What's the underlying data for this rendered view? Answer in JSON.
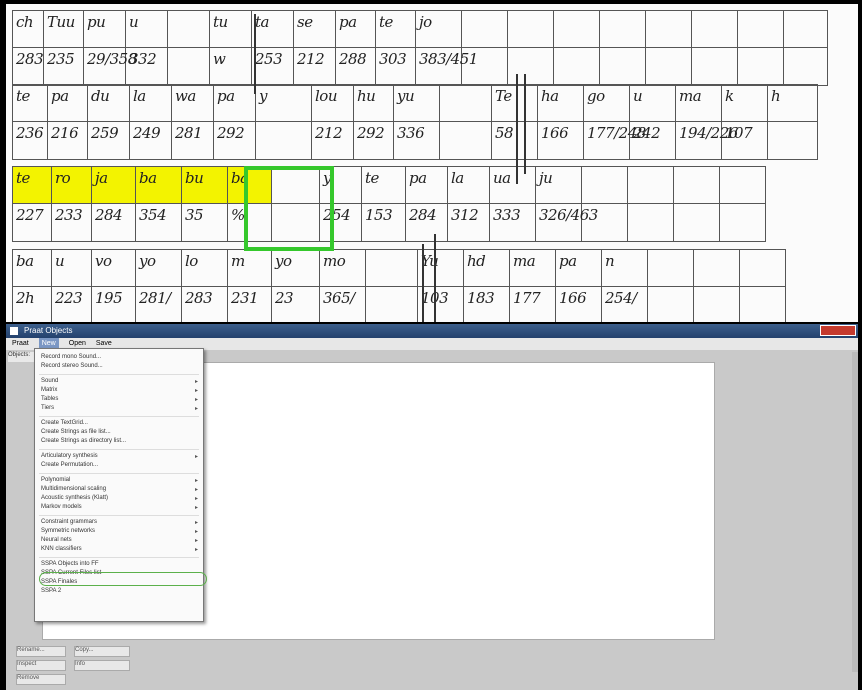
{
  "sheet": {
    "rows": [
      {
        "labels": [
          "ch",
          "Tuu",
          "pu",
          "u",
          "",
          "tu",
          "ta",
          "se",
          "pa",
          "te",
          "jo",
          "",
          "",
          "",
          "",
          "",
          "",
          "",
          ""
        ],
        "values": [
          "283",
          "235",
          "29/358",
          "332",
          "",
          "w",
          "253",
          "212",
          "288",
          "303",
          "383/451",
          "",
          "",
          "",
          "",
          "",
          "",
          "",
          ""
        ]
      },
      {
        "labels": [
          "te",
          "pa",
          "du",
          "la",
          "wa",
          "pa",
          "y",
          "lou",
          "hu",
          "yu",
          "",
          "Te",
          "ha",
          "go",
          "u",
          "ma",
          "k",
          "h"
        ],
        "values": [
          "236",
          "216",
          "259",
          "249",
          "281",
          "292",
          "",
          "212",
          "292",
          "336",
          "",
          "58",
          "166",
          "177/248",
          "242",
          "194/226",
          "107",
          ""
        ]
      },
      {
        "labels": [
          "te",
          "ro",
          "ja",
          "ba",
          "bu",
          "ba",
          "",
          "y",
          "te",
          "pa",
          "la",
          "ua",
          "ju",
          "",
          "",
          "",
          ""
        ],
        "values": [
          "227",
          "233",
          "284",
          "354",
          "35",
          "%",
          "",
          "254",
          "153",
          "284",
          "312",
          "333",
          "326/463",
          "",
          "",
          "",
          ""
        ]
      },
      {
        "labels": [
          "ba",
          "u",
          "vo",
          "yo",
          "lo",
          "m",
          "yo",
          "mo",
          "",
          "Yu",
          "hd",
          "ma",
          "pa",
          "n",
          "",
          "",
          ""
        ],
        "values": [
          "2h",
          "223",
          "195",
          "281/",
          "283",
          "231",
          "23",
          "365/",
          "",
          "103",
          "183",
          "177",
          "166",
          "254/",
          "",
          "",
          ""
        ]
      }
    ]
  },
  "window": {
    "title": "Praat Objects",
    "menus": [
      "Praat",
      "New",
      "Open",
      "Save"
    ],
    "active_menu": "New",
    "objects_label": "Objects:",
    "dropdown_items": [
      {
        "label": "Record mono Sound...",
        "submenu": false
      },
      {
        "label": "Record stereo Sound...",
        "submenu": false
      },
      {
        "label": "Sound",
        "submenu": true
      },
      {
        "label": "Matrix",
        "submenu": true
      },
      {
        "label": "Tables",
        "submenu": true
      },
      {
        "label": "Tiers",
        "submenu": true
      },
      {
        "label": "Create TextGrid...",
        "submenu": false
      },
      {
        "label": "Create Strings as file list...",
        "submenu": false
      },
      {
        "label": "Create Strings as directory list...",
        "submenu": false
      },
      {
        "label": "Articulatory synthesis",
        "submenu": true
      },
      {
        "label": "Create Permutation...",
        "submenu": false
      },
      {
        "label": "Polynomial",
        "submenu": true
      },
      {
        "label": "Multidimensional scaling",
        "submenu": true
      },
      {
        "label": "Acoustic synthesis (Klatt)",
        "submenu": true
      },
      {
        "label": "Markov models",
        "submenu": true
      },
      {
        "label": "Constraint grammars",
        "submenu": true
      },
      {
        "label": "Symmetric networks",
        "submenu": true
      },
      {
        "label": "Neural nets",
        "submenu": true
      },
      {
        "label": "KNN classifiers",
        "submenu": true
      },
      {
        "label": "SSPA Objects into FF",
        "submenu": false
      },
      {
        "label": "SSPA Current Files list",
        "submenu": false
      },
      {
        "label": "SSPA Finales",
        "submenu": false
      },
      {
        "label": "SSPA 2",
        "submenu": false
      }
    ],
    "bottom_buttons": [
      "Rename...",
      "Copy...",
      "Inspect",
      "Info",
      "Remove"
    ]
  }
}
